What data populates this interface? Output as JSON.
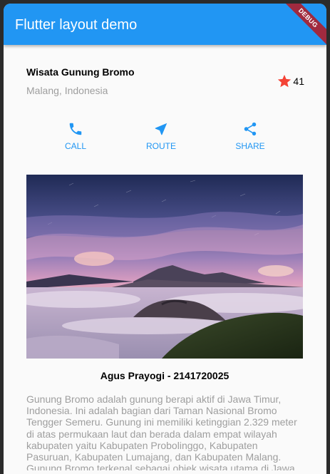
{
  "app_bar": {
    "title": "Flutter layout demo",
    "color": "#2196f3",
    "debug_banner": "DEBUG"
  },
  "title_section": {
    "name": "Wisata Gunung Bromo",
    "location": "Malang, Indonesia",
    "rating_icon": "star-icon",
    "rating_color": "#f44336",
    "rating_count": "41"
  },
  "buttons": [
    {
      "label": "CALL",
      "icon": "phone-icon"
    },
    {
      "label": "ROUTE",
      "icon": "near-me-icon"
    },
    {
      "label": "SHARE",
      "icon": "share-icon"
    }
  ],
  "image": {
    "subject": "bromo-landscape"
  },
  "caption": "Agus Prayogi - 2141720025",
  "description": "Gunung Bromo adalah gunung berapi aktif di Jawa Timur, Indonesia. Ini adalah bagian dari Taman Nasional Bromo Tengger Semeru. Gunung ini memiliki ketinggian 2.329 meter di atas permukaan laut dan berada dalam empat wilayah kabupaten yaitu Kabupaten Probolinggo, Kabupaten Pasuruan, Kabupaten Lumajang, dan Kabupaten Malang. Gunung Bromo terkenal sebagai objek wisata utama di Jawa Timur. Gunung"
}
